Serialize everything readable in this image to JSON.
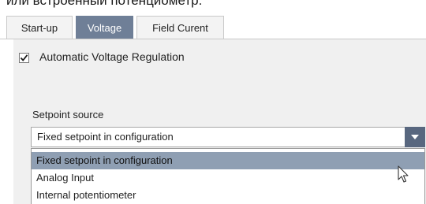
{
  "caption": "или встроенный потенциометр.",
  "tabs": [
    {
      "label": "Start-up"
    },
    {
      "label": "Voltage"
    },
    {
      "label": "Field Curent"
    }
  ],
  "avr": {
    "label": "Automatic Voltage Regulation",
    "checked": true
  },
  "setpoint": {
    "label": "Setpoint source",
    "value": "Fixed setpoint in configuration",
    "options": [
      {
        "label": "Fixed setpoint in configuration"
      },
      {
        "label": "Analog Input"
      },
      {
        "label": "Internal potentiometer"
      }
    ]
  },
  "colors": {
    "active_tab": "#6f7f97",
    "arrow_button": "#58677f",
    "highlight": "#8f9fb3"
  }
}
